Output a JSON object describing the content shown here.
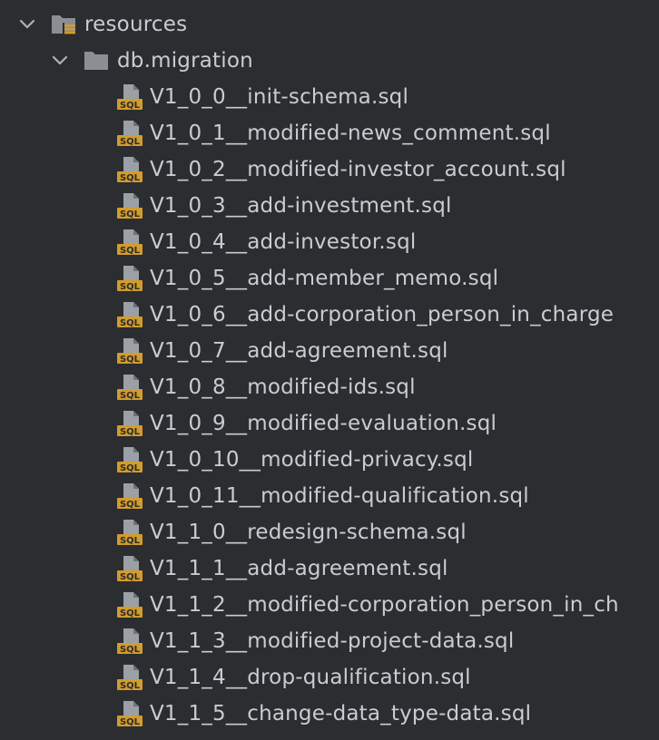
{
  "tree": {
    "root": {
      "label": "resources",
      "icon": "resources-folder-icon",
      "expanded": true
    },
    "folder": {
      "label": "db.migration",
      "icon": "folder-icon",
      "expanded": true
    },
    "files": [
      {
        "label": "V1_0_0__init-schema.sql",
        "icon": "sql-file-icon"
      },
      {
        "label": "V1_0_1__modified-news_comment.sql",
        "icon": "sql-file-icon"
      },
      {
        "label": "V1_0_2__modified-investor_account.sql",
        "icon": "sql-file-icon"
      },
      {
        "label": "V1_0_3__add-investment.sql",
        "icon": "sql-file-icon"
      },
      {
        "label": "V1_0_4__add-investor.sql",
        "icon": "sql-file-icon"
      },
      {
        "label": "V1_0_5__add-member_memo.sql",
        "icon": "sql-file-icon"
      },
      {
        "label": "V1_0_6__add-corporation_person_in_charge",
        "icon": "sql-file-icon"
      },
      {
        "label": "V1_0_7__add-agreement.sql",
        "icon": "sql-file-icon"
      },
      {
        "label": "V1_0_8__modified-ids.sql",
        "icon": "sql-file-icon"
      },
      {
        "label": "V1_0_9__modified-evaluation.sql",
        "icon": "sql-file-icon"
      },
      {
        "label": "V1_0_10__modified-privacy.sql",
        "icon": "sql-file-icon"
      },
      {
        "label": "V1_0_11__modified-qualification.sql",
        "icon": "sql-file-icon"
      },
      {
        "label": "V1_1_0__redesign-schema.sql",
        "icon": "sql-file-icon"
      },
      {
        "label": "V1_1_1__add-agreement.sql",
        "icon": "sql-file-icon"
      },
      {
        "label": "V1_1_2__modified-corporation_person_in_ch",
        "icon": "sql-file-icon"
      },
      {
        "label": "V1_1_3__modified-project-data.sql",
        "icon": "sql-file-icon"
      },
      {
        "label": "V1_1_4__drop-qualification.sql",
        "icon": "sql-file-icon"
      },
      {
        "label": "V1_1_5__change-data_type-data.sql",
        "icon": "sql-file-icon"
      }
    ]
  },
  "colors": {
    "background": "#2b2d30",
    "text": "#c9ccd1",
    "folder": "#8b8e94",
    "sql_badge": "#d39c2b",
    "sql_page": "#9aa0a6"
  }
}
